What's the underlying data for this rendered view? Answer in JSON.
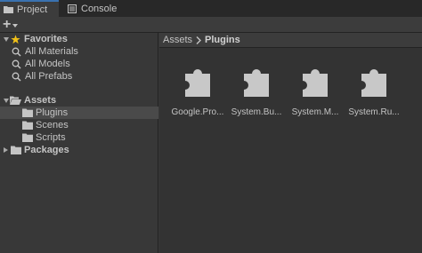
{
  "tabs": [
    {
      "label": "Project",
      "icon": "folder-icon",
      "active": true
    },
    {
      "label": "Console",
      "icon": "console-icon",
      "active": false
    }
  ],
  "toolbar": {
    "create_label": "+"
  },
  "tree": {
    "favorites": {
      "label": "Favorites",
      "items": [
        "All Materials",
        "All Models",
        "All Prefabs"
      ]
    },
    "assets": {
      "label": "Assets",
      "children": [
        "Plugins",
        "Scenes",
        "Scripts"
      ],
      "selected": "Plugins"
    },
    "packages": {
      "label": "Packages"
    }
  },
  "breadcrumb": {
    "root": "Assets",
    "current": "Plugins"
  },
  "assets": [
    "Google.Pro...",
    "System.Bu...",
    "System.M...",
    "System.Ru..."
  ],
  "colors": {
    "accent": "#3a72b0",
    "star": "#f0c018",
    "selection": "#4a4a4a",
    "puzzle": "#c8c8c8"
  }
}
